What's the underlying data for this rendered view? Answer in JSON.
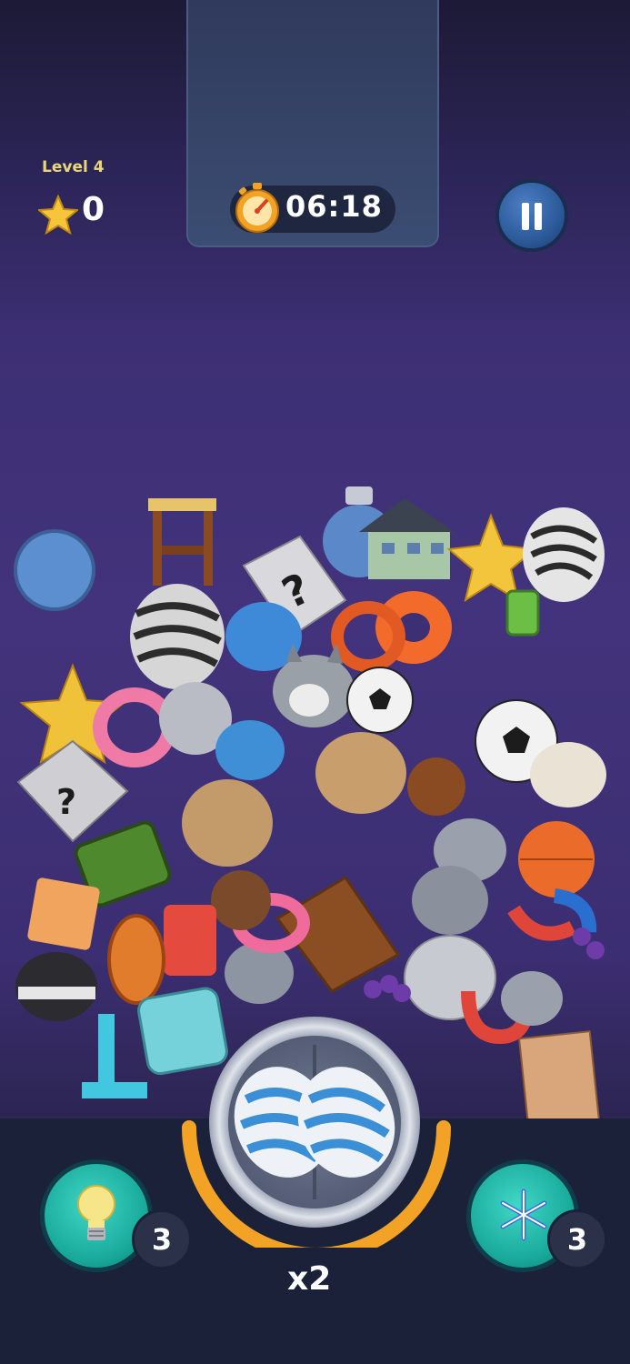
{
  "hud": {
    "level_label": "Level 4",
    "score": "0",
    "timer": "06:18",
    "pause_icon": "pause-icon",
    "star_icon": "star-icon",
    "stopwatch_icon": "stopwatch-icon"
  },
  "boosters": {
    "hint": {
      "icon": "lightbulb-icon",
      "count": "3"
    },
    "freeze": {
      "icon": "snowflake-icon",
      "count": "3"
    }
  },
  "collector": {
    "multiplier": "x2",
    "items": [
      "striped-egg",
      "striped-egg"
    ]
  },
  "colors": {
    "background": "#3d2f74",
    "bottom_bar": "#1a2138",
    "booster": "#18a99a",
    "timer_pill": "#1f2640",
    "arc": "#f2a326"
  }
}
